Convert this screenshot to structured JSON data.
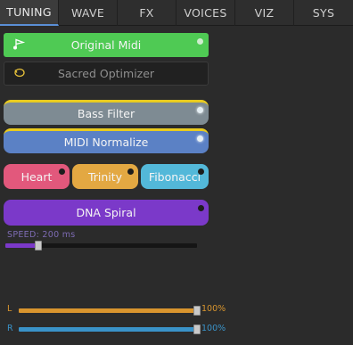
{
  "tabs": [
    {
      "label": "TUNING",
      "active": true
    },
    {
      "label": "WAVE",
      "active": false
    },
    {
      "label": "FX",
      "active": false
    },
    {
      "label": "VOICES",
      "active": false
    },
    {
      "label": "VIZ",
      "active": false
    },
    {
      "label": "SYS",
      "active": false
    }
  ],
  "buttons": {
    "original_midi": {
      "label": "Original Midi",
      "color": "#4fca54",
      "icon": "music-note-flag-icon"
    },
    "sacred_optimizer": {
      "label": "Sacred Optimizer",
      "color": "#222222",
      "icon": "circle-arrow-icon"
    },
    "bass_filter": {
      "label": "Bass Filter",
      "color": "#7e8b93"
    },
    "midi_normalize": {
      "label": "MIDI Normalize",
      "color": "#5b81c5"
    },
    "heart": {
      "label": "Heart",
      "color": "#e2587c"
    },
    "trinity": {
      "label": "Trinity",
      "color": "#e3a842"
    },
    "fibonacci": {
      "label": "Fibonacci",
      "color": "#53b8d9"
    },
    "dna_spiral": {
      "label": "DNA Spiral",
      "color": "#7b39c9"
    }
  },
  "speed": {
    "label": "SPEED: 200 ms",
    "fraction": 0.17
  },
  "channels": {
    "left": {
      "label": "L",
      "value_text": "100%",
      "fraction": 1.0,
      "color": "#d9952e"
    },
    "right": {
      "label": "R",
      "value_text": "100%",
      "fraction": 1.0,
      "color": "#3a93c9"
    }
  }
}
